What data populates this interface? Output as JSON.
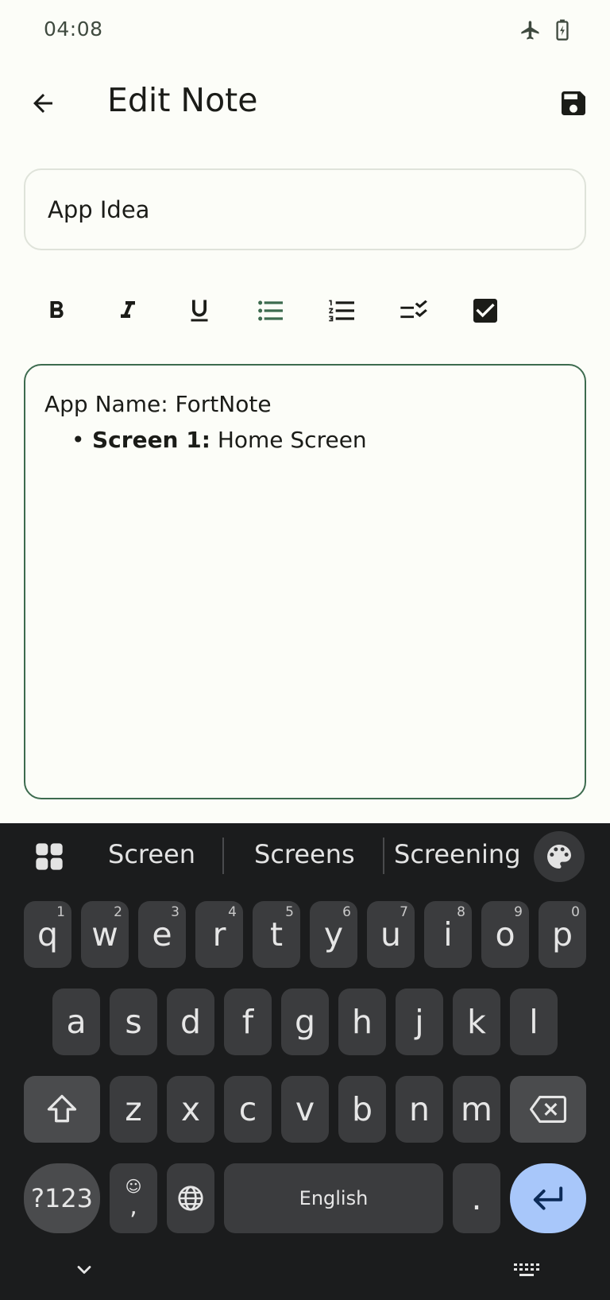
{
  "status_bar": {
    "time": "04:08",
    "icons": [
      "airplane-icon",
      "battery-charging-icon"
    ]
  },
  "app_bar": {
    "title": "Edit Note",
    "back_icon": "arrow-back-icon",
    "save_icon": "save-icon"
  },
  "note": {
    "title_value": "App Idea",
    "content_line1": "App Name: FortNote",
    "bullet_char": "•",
    "bullet_bold": "Screen 1:",
    "bullet_rest": " Home Screen"
  },
  "toolbar": {
    "buttons": [
      "bold-icon",
      "italic-icon",
      "underline-icon",
      "bulleted-list-icon",
      "numbered-list-icon",
      "checklist-icon",
      "checkbox-icon"
    ],
    "active_color": "#3d6b4f"
  },
  "keyboard": {
    "suggestions": [
      "Screen",
      "Screens",
      "Screening"
    ],
    "row1": [
      {
        "k": "q",
        "h": "1"
      },
      {
        "k": "w",
        "h": "2"
      },
      {
        "k": "e",
        "h": "3"
      },
      {
        "k": "r",
        "h": "4"
      },
      {
        "k": "t",
        "h": "5"
      },
      {
        "k": "y",
        "h": "6"
      },
      {
        "k": "u",
        "h": "7"
      },
      {
        "k": "i",
        "h": "8"
      },
      {
        "k": "o",
        "h": "9"
      },
      {
        "k": "p",
        "h": "0"
      }
    ],
    "row2": [
      "a",
      "s",
      "d",
      "f",
      "g",
      "h",
      "j",
      "k",
      "l"
    ],
    "row3": [
      "z",
      "x",
      "c",
      "v",
      "b",
      "n",
      "m"
    ],
    "symbols_label": "?123",
    "emoji_comma": ",",
    "space_label": "English",
    "period_label": ".",
    "accent_color": "#a8c7fa"
  }
}
